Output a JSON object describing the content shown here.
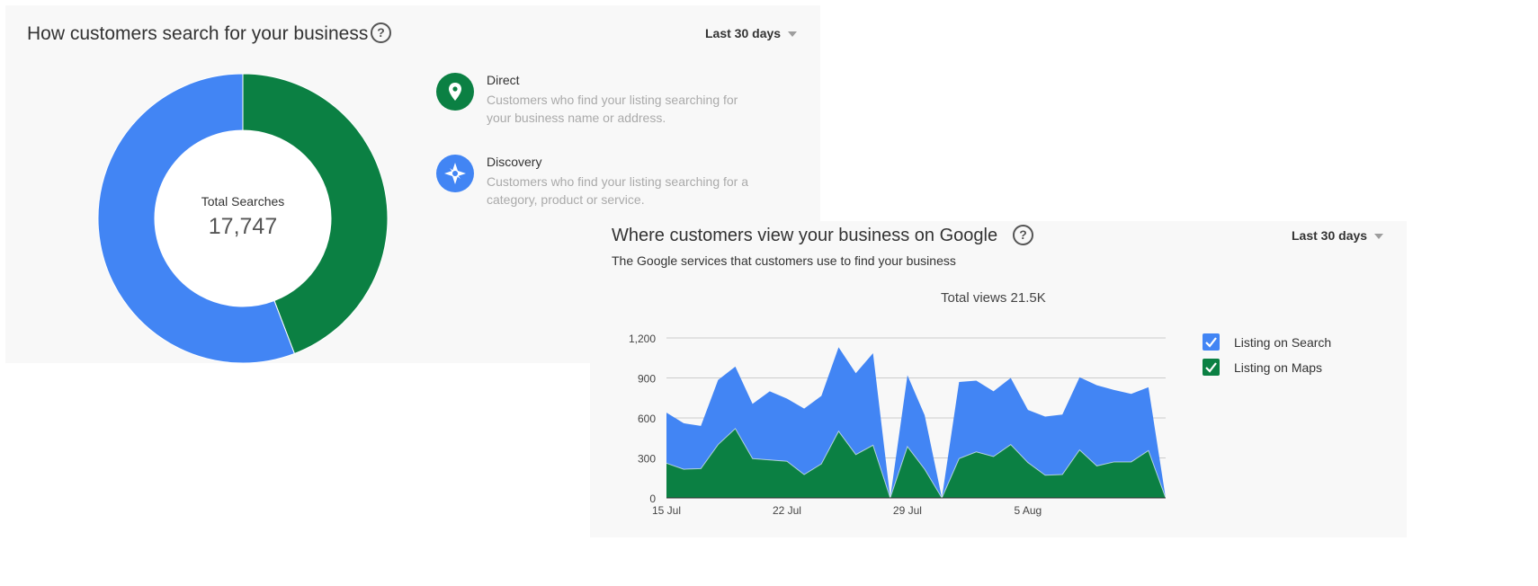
{
  "search_card": {
    "title": "How customers search for your business",
    "range_label": "Last 30 days",
    "center_label": "Total Searches",
    "center_value": "17,747",
    "legend": [
      {
        "name": "Direct",
        "description": "Customers who find your listing searching for your business name or address.",
        "color": "#0b8043",
        "icon": "location-pin-icon"
      },
      {
        "name": "Discovery",
        "description": "Customers who find your listing searching for a category, product or service.",
        "color": "#4285f4",
        "icon": "compass-icon"
      }
    ]
  },
  "views_card": {
    "title": "Where customers view your business on Google",
    "subtitle": "The Google services that customers use to find your business",
    "range_label": "Last 30 days",
    "total_views": "Total views 21.5K"
  },
  "chart_data": [
    {
      "type": "pie",
      "title": "How customers search for your business",
      "center_text": "Total Searches 17,747",
      "slices": [
        {
          "name": "Direct",
          "fraction": 0.442,
          "color": "#0b8043"
        },
        {
          "name": "Discovery",
          "fraction": 0.558,
          "color": "#4285f4"
        }
      ],
      "donut": true
    },
    {
      "type": "area",
      "stacked": true,
      "title": "Total views 21.5K",
      "x": [
        "15 Jul",
        "16 Jul",
        "17 Jul",
        "18 Jul",
        "19 Jul",
        "20 Jul",
        "21 Jul",
        "22 Jul",
        "23 Jul",
        "24 Jul",
        "25 Jul",
        "26 Jul",
        "27 Jul",
        "28 Jul",
        "29 Jul",
        "30 Jul",
        "31 Jul",
        "1 Aug",
        "2 Aug",
        "3 Aug",
        "4 Aug",
        "5 Aug",
        "6 Aug",
        "7 Aug",
        "8 Aug",
        "9 Aug",
        "10 Aug",
        "11 Aug",
        "12 Aug",
        "13 Aug"
      ],
      "x_ticks": [
        "15 Jul",
        "22 Jul",
        "29 Jul",
        "5 Aug"
      ],
      "y_ticks": [
        "0",
        "300",
        "600",
        "900",
        "1,200"
      ],
      "ylim": [
        0,
        1200
      ],
      "grid": true,
      "legend_position": "right",
      "series": [
        {
          "name": "Listing on Maps",
          "color": "#0b8043",
          "values": [
            260,
            215,
            220,
            400,
            520,
            295,
            285,
            275,
            175,
            255,
            500,
            325,
            395,
            0,
            385,
            215,
            0,
            295,
            345,
            310,
            400,
            265,
            170,
            175,
            360,
            240,
            270,
            270,
            355,
            0
          ]
        },
        {
          "name": "Listing on Search",
          "color": "#4285f4",
          "values": [
            380,
            345,
            320,
            485,
            465,
            410,
            515,
            470,
            495,
            510,
            630,
            610,
            690,
            0,
            535,
            405,
            0,
            575,
            535,
            490,
            500,
            395,
            440,
            450,
            545,
            605,
            540,
            510,
            475,
            0
          ]
        }
      ],
      "totals": [
        640,
        560,
        540,
        885,
        985,
        705,
        800,
        745,
        670,
        765,
        1130,
        935,
        1085,
        0,
        920,
        620,
        0,
        870,
        880,
        800,
        900,
        660,
        610,
        625,
        905,
        845,
        810,
        780,
        830,
        0
      ]
    }
  ]
}
